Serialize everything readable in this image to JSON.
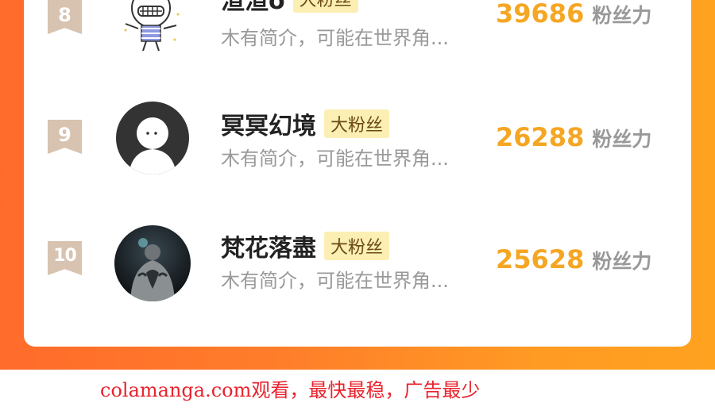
{
  "rankings": [
    {
      "rank": "8",
      "name": "渲渲o",
      "tag": "大粉丝",
      "bio": "木有简介，可能在世界角...",
      "score": "39686",
      "score_label": "粉丝力",
      "avatar_icon": "cartoon-character-avatar"
    },
    {
      "rank": "9",
      "name": "冥冥幻境",
      "tag": "大粉丝",
      "bio": "木有简介，可能在世界角...",
      "score": "26288",
      "score_label": "粉丝力",
      "avatar_icon": "default-user-avatar"
    },
    {
      "rank": "10",
      "name": "梵花落盡",
      "tag": "大粉丝",
      "bio": "木有简介，可能在世界角...",
      "score": "25628",
      "score_label": "粉丝力",
      "avatar_icon": "tattoo-back-photo-avatar"
    }
  ],
  "watermark": "colamanga.com观看，最快最稳，广告最少",
  "colors": {
    "accent": "#f5a623",
    "background_gradient_start": "#ff6b2b",
    "background_gradient_end": "#ffa21f",
    "tag_bg": "#fbefb3",
    "watermark": "#e8232d"
  }
}
